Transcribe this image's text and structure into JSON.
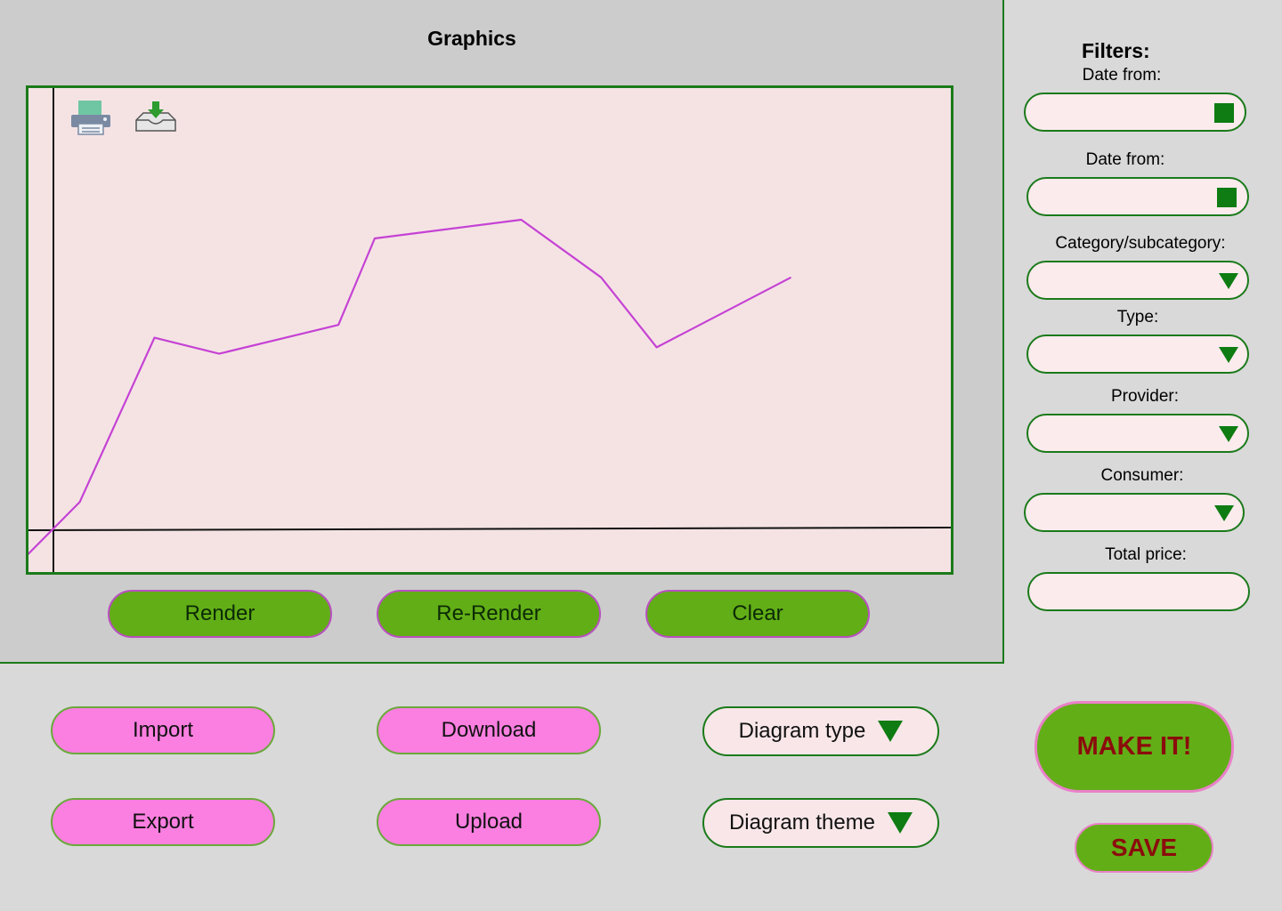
{
  "graphics": {
    "title": "Graphics",
    "buttons": {
      "render": "Render",
      "re_render": "Re-Render",
      "clear": "Clear"
    }
  },
  "toolbar_icons": [
    "printer-icon",
    "download-tray-icon"
  ],
  "chart_data": {
    "type": "line",
    "title": "",
    "xlabel": "",
    "ylabel": "",
    "grid": false,
    "series": [
      {
        "color": "#c542d4",
        "points": [
          [
            -0.27,
            -0.5
          ],
          [
            0.26,
            0.51
          ],
          [
            1.0,
            3.59
          ],
          [
            1.64,
            3.29
          ],
          [
            2.82,
            3.83
          ],
          [
            3.18,
            5.45
          ],
          [
            4.63,
            5.8
          ],
          [
            5.42,
            4.72
          ],
          [
            5.97,
            3.41
          ],
          [
            7.3,
            4.72
          ]
        ]
      }
    ]
  },
  "actions": {
    "import": "Import",
    "download": "Download",
    "export": "Export",
    "upload": "Upload",
    "diagram_type": "Diagram type",
    "diagram_theme": "Diagram theme",
    "make_it": "MAKE IT!",
    "save": "SAVE"
  },
  "filters": {
    "title": "Filters:",
    "date_from_1": "Date from:",
    "date_from_2": "Date from:",
    "category": "Category/subcategory:",
    "type": "Type:",
    "provider": "Provider:",
    "consumer": "Consumer:",
    "total_price": "Total price:"
  },
  "colors": {
    "accent_green": "#62ae17",
    "dark_green": "#0e7c12",
    "pink": "#fa7fe0",
    "chart_line": "#c542d4",
    "chart_bg": "#f5e3e4",
    "save_text": "#8b0c0c"
  }
}
